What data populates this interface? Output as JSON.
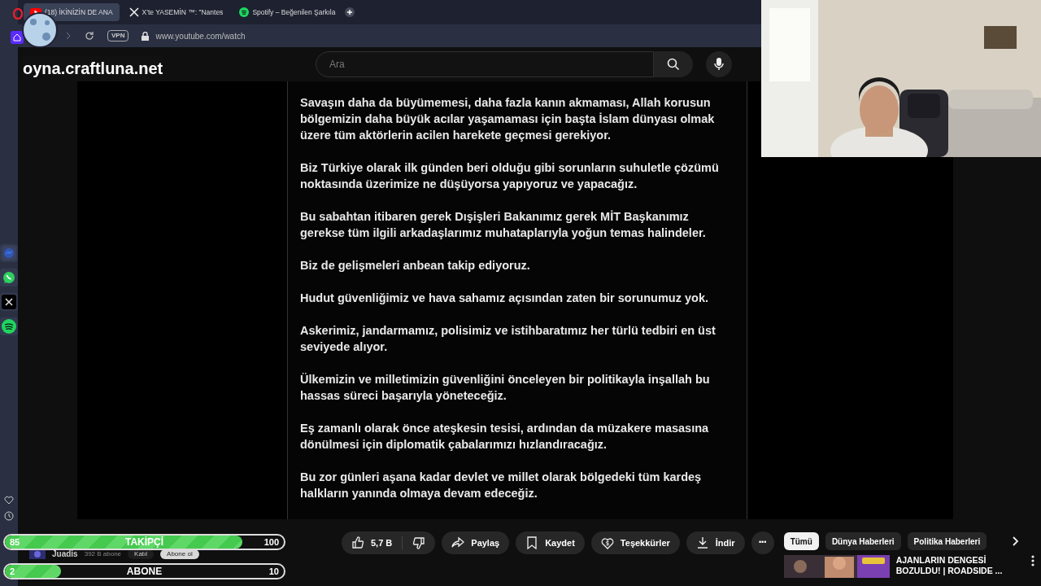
{
  "browser": {
    "tabs": [
      {
        "label": "(18) İKİNİZİN DE ANA",
        "selected": true
      },
      {
        "label": "X'te YASEMİN ™: \"Nantes",
        "selected": false
      },
      {
        "label": "Spotify – Beğenilen Şarkıla",
        "selected": false
      }
    ],
    "url": "www.youtube.com/watch",
    "vpn": "VPN"
  },
  "overlay_text": "oyna.craftluna.net",
  "search": {
    "placeholder": "Ara"
  },
  "paragraphs": [
    "Savaşın daha da büyümemesi, daha fazla kanın akmaması, Allah korusun bölgemizin daha büyük acılar yaşamaması için başta İslam dünyası olmak üzere tüm aktörlerin acilen harekete geçmesi gerekiyor.",
    "Biz Türkiye olarak ilk günden beri olduğu gibi sorunların suhuletle çözümü noktasında üzerimize ne düşüyorsa yapıyoruz ve yapacağız.",
    "Bu sabahtan itibaren gerek Dışişleri Bakanımız gerek MİT Başkanımız gerekse tüm ilgili arkadaşlarımız muhataplarıyla yoğun temas halindeler.",
    "Biz de gelişmeleri anbean takip ediyoruz.",
    "Hudut güvenliğimiz ve hava sahamız açısından zaten bir sorunumuz yok.",
    "Askerimiz, jandarmamız, polisimiz ve istihbaratımız her türlü tedbiri en üst seviyede alıyor.",
    "Ülkemizin ve milletimizin güvenliğini önceleyen bir politikayla inşallah bu hassas süreci başarıyla yöneteceğiz.",
    "Eş zamanlı olarak önce ateşkesin tesisi, ardından da müzakere masasına dönülmesi için diplomatik çabalarımızı hızlandıracağız.",
    "Bu zor günleri aşana kadar devlet ve millet olarak bölgedeki tüm kardeş halkların yanında olmaya devam edeceğiz."
  ],
  "video": {
    "channel": "Juadis",
    "subscribers": "392 B abone",
    "join": "Katıl",
    "subscribe": "Abone ol",
    "actions": [
      {
        "kind": "like",
        "label": "5,7 B"
      },
      {
        "kind": "share",
        "label": "Paylaş"
      },
      {
        "kind": "save",
        "label": "Kaydet"
      },
      {
        "kind": "thanks",
        "label": "Teşekkürler"
      },
      {
        "kind": "download",
        "label": "İndir"
      }
    ],
    "more": "•••"
  },
  "goals": [
    {
      "current": "85",
      "label": "TAKİPÇİ",
      "target": "100",
      "level": 0.85
    },
    {
      "current": "2",
      "label": "ABONE",
      "target": "10",
      "level": 0.2
    }
  ],
  "chips": [
    {
      "label": "Tümü",
      "selected": true
    },
    {
      "label": "Dünya Haberleri",
      "selected": false
    },
    {
      "label": "Politika Haberleri",
      "selected": false
    }
  ],
  "recommended": [
    {
      "title": "AJANLARIN DENGESİ BOZULDU! | ROADSIDE ..."
    }
  ]
}
